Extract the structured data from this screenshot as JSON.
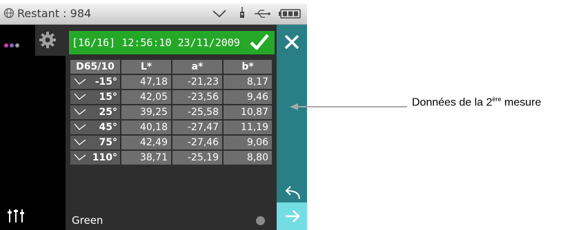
{
  "status_bar": {
    "remaining_label": "Restant : 984",
    "icons": [
      "globe-icon",
      "chevron-down-icon",
      "sensor-icon",
      "usb-icon",
      "battery-icon"
    ]
  },
  "header": {
    "text": "[16/16] 12:56:10 23/11/2009",
    "check_icon": "check-icon",
    "color": "#25a828"
  },
  "table": {
    "columns": [
      "D65/10",
      "L*",
      "a*",
      "b*"
    ],
    "rows": [
      {
        "angle": "-15°",
        "L": "47,18",
        "a": "-21,23",
        "b": "8,17"
      },
      {
        "angle": "15°",
        "L": "42,05",
        "a": "-23,56",
        "b": "9,46"
      },
      {
        "angle": "25°",
        "L": "39,25",
        "a": "-25,58",
        "b": "10,87"
      },
      {
        "angle": "45°",
        "L": "40,18",
        "a": "-27,47",
        "b": "11,19"
      },
      {
        "angle": "75°",
        "L": "42,49",
        "a": "-27,46",
        "b": "9,06"
      },
      {
        "angle": "110°",
        "L": "38,71",
        "a": "-25,19",
        "b": "8,80"
      }
    ]
  },
  "footer": {
    "name": "Green"
  },
  "right_column": {
    "close_icon": "close-icon",
    "back_icon": "back-arrow-icon",
    "next_icon": "next-arrow-icon",
    "accent": "#2a7f86",
    "active": "#74dde4"
  },
  "annotation": {
    "prefix": "Données de la 2",
    "superscript": "ère",
    "suffix": " mesure"
  }
}
